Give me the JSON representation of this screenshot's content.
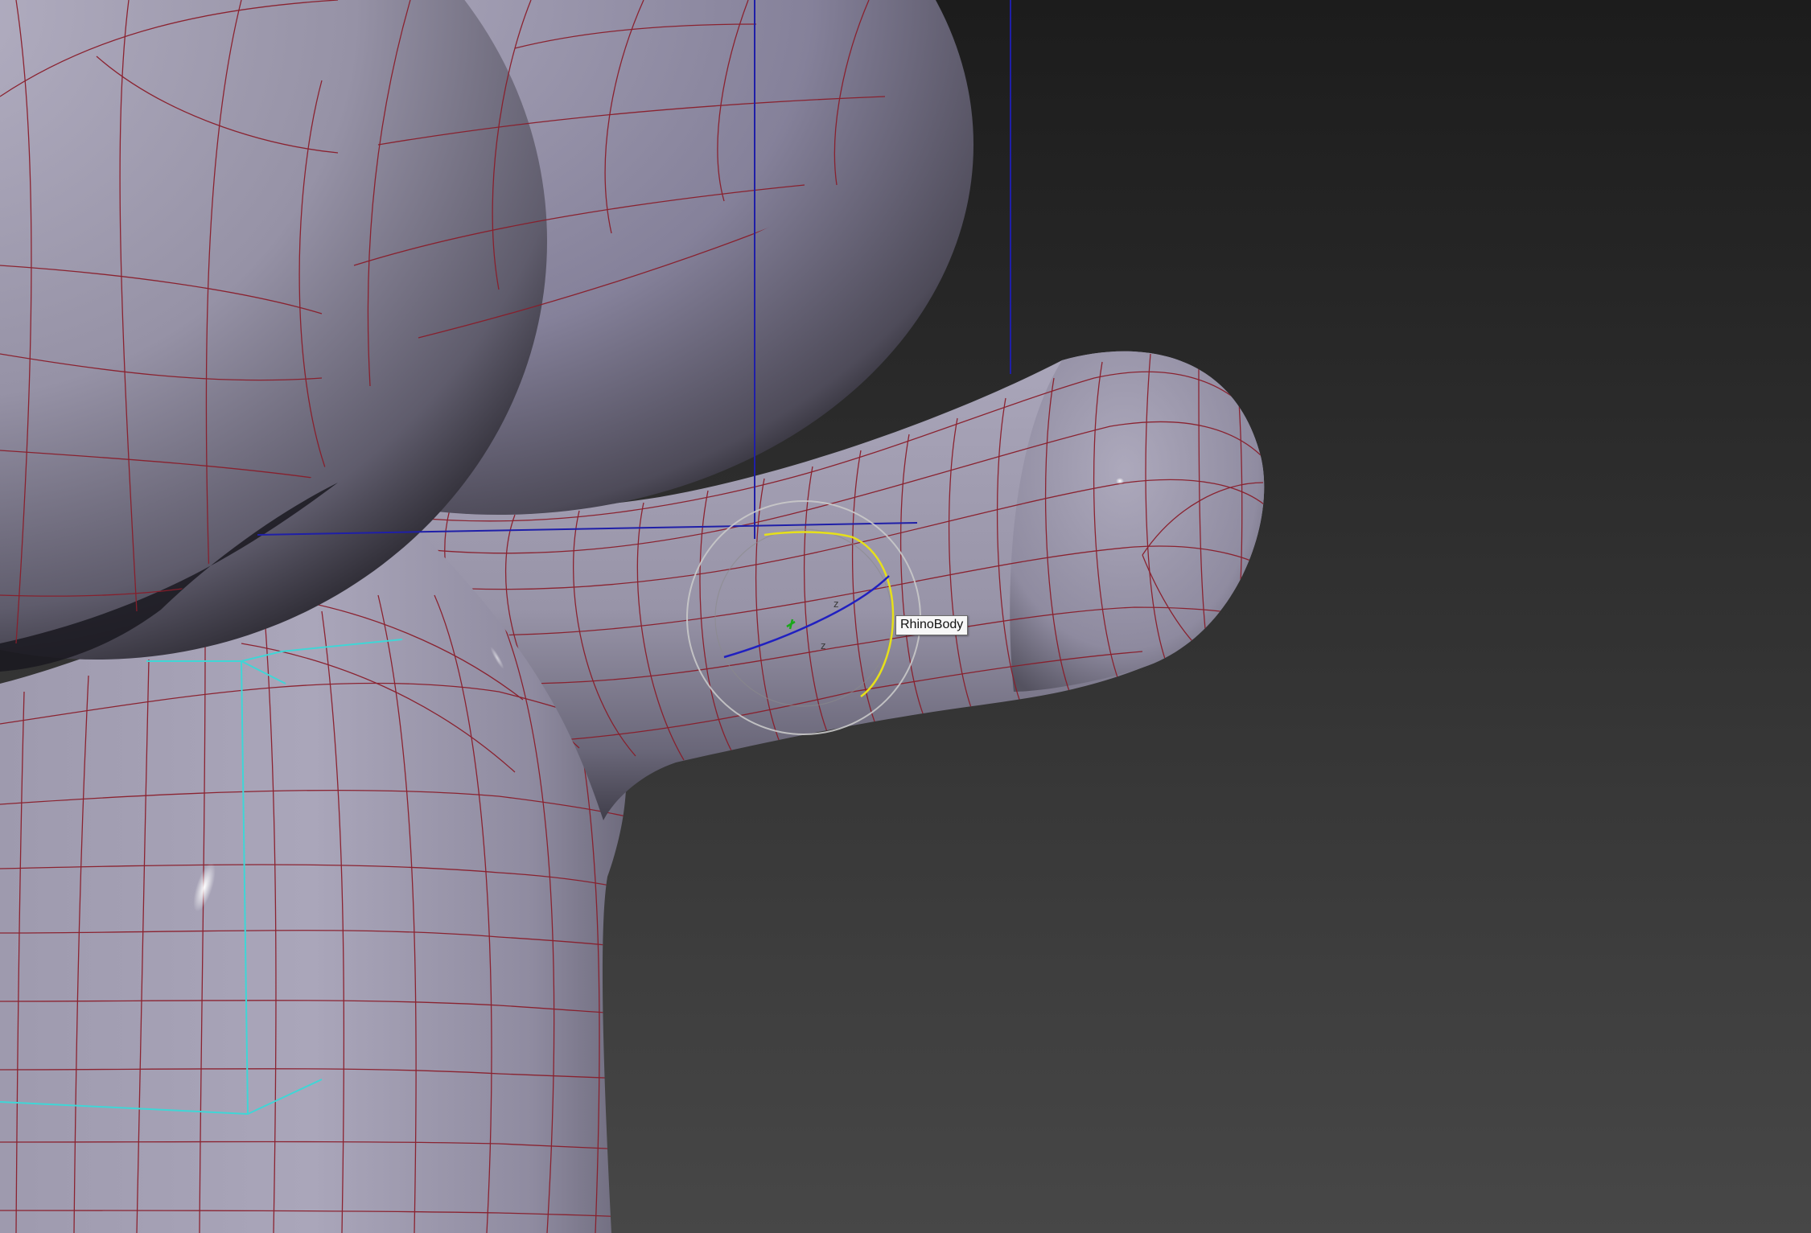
{
  "viewport": {
    "background_top": "#1c1c1c",
    "background_bottom": "#474747",
    "mesh_color": "#9b97ab",
    "wire_color": "#8a1d2a",
    "selection_box_color": "#1f1fa8",
    "helper_color": "#3fd6d6"
  },
  "tooltip": {
    "object_name": "RhinoBody"
  },
  "gizmo": {
    "type": "rotate-gizmo",
    "axis_labels": [
      "z",
      "z"
    ],
    "colors": {
      "view_circle": "#c9c9c9",
      "active_axis": "#e6e01a",
      "z_axis": "#2020c0",
      "y_axis": "#1aa81a"
    }
  }
}
